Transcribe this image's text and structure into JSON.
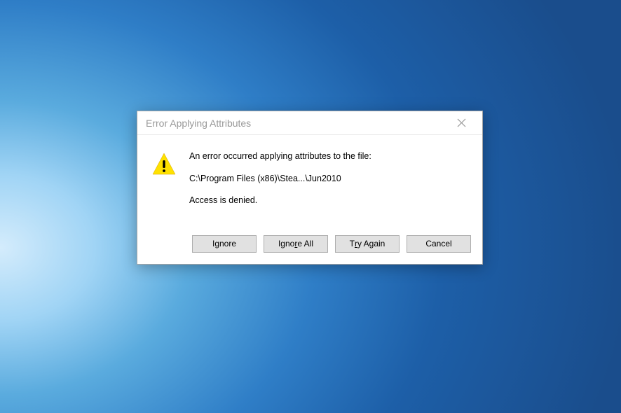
{
  "dialog": {
    "title": "Error Applying Attributes",
    "message_heading": "An error occurred applying attributes to the file:",
    "file_path": "C:\\Program Files (x86)\\Stea...\\Jun2010",
    "error_detail": "Access is denied."
  },
  "buttons": {
    "ignore": {
      "pre": "I",
      "key": "g",
      "post": "nore"
    },
    "ignore_all": {
      "pre": "Igno",
      "key": "r",
      "post": "e All"
    },
    "try_again": {
      "pre": "T",
      "key": "r",
      "post": "y Again"
    },
    "cancel": {
      "pre": "",
      "key": "",
      "post": "Cancel"
    }
  }
}
